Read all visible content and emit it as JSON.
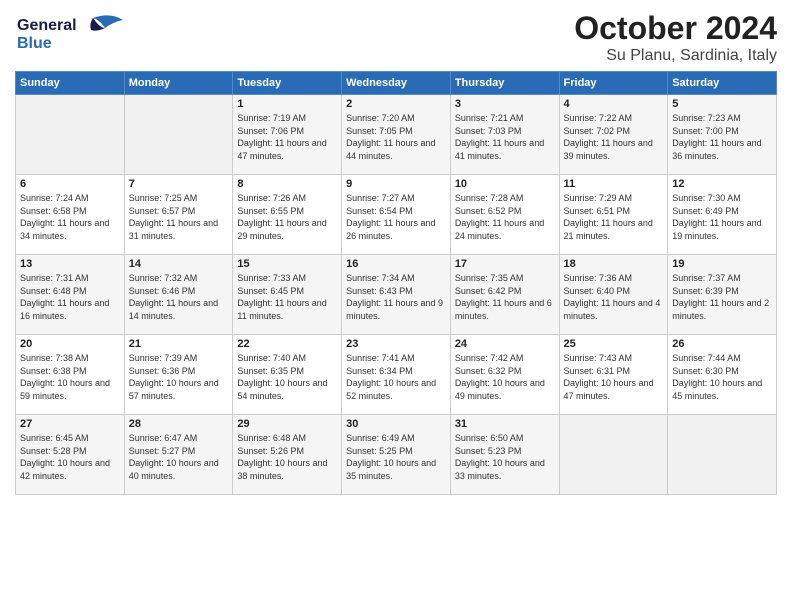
{
  "logo": {
    "line1": "General",
    "line2": "Blue"
  },
  "title": "October 2024",
  "subtitle": "Su Planu, Sardinia, Italy",
  "weekdays": [
    "Sunday",
    "Monday",
    "Tuesday",
    "Wednesday",
    "Thursday",
    "Friday",
    "Saturday"
  ],
  "weeks": [
    [
      {
        "day": "",
        "info": ""
      },
      {
        "day": "",
        "info": ""
      },
      {
        "day": "1",
        "info": "Sunrise: 7:19 AM\nSunset: 7:06 PM\nDaylight: 11 hours and 47 minutes."
      },
      {
        "day": "2",
        "info": "Sunrise: 7:20 AM\nSunset: 7:05 PM\nDaylight: 11 hours and 44 minutes."
      },
      {
        "day": "3",
        "info": "Sunrise: 7:21 AM\nSunset: 7:03 PM\nDaylight: 11 hours and 41 minutes."
      },
      {
        "day": "4",
        "info": "Sunrise: 7:22 AM\nSunset: 7:02 PM\nDaylight: 11 hours and 39 minutes."
      },
      {
        "day": "5",
        "info": "Sunrise: 7:23 AM\nSunset: 7:00 PM\nDaylight: 11 hours and 36 minutes."
      }
    ],
    [
      {
        "day": "6",
        "info": "Sunrise: 7:24 AM\nSunset: 6:58 PM\nDaylight: 11 hours and 34 minutes."
      },
      {
        "day": "7",
        "info": "Sunrise: 7:25 AM\nSunset: 6:57 PM\nDaylight: 11 hours and 31 minutes."
      },
      {
        "day": "8",
        "info": "Sunrise: 7:26 AM\nSunset: 6:55 PM\nDaylight: 11 hours and 29 minutes."
      },
      {
        "day": "9",
        "info": "Sunrise: 7:27 AM\nSunset: 6:54 PM\nDaylight: 11 hours and 26 minutes."
      },
      {
        "day": "10",
        "info": "Sunrise: 7:28 AM\nSunset: 6:52 PM\nDaylight: 11 hours and 24 minutes."
      },
      {
        "day": "11",
        "info": "Sunrise: 7:29 AM\nSunset: 6:51 PM\nDaylight: 11 hours and 21 minutes."
      },
      {
        "day": "12",
        "info": "Sunrise: 7:30 AM\nSunset: 6:49 PM\nDaylight: 11 hours and 19 minutes."
      }
    ],
    [
      {
        "day": "13",
        "info": "Sunrise: 7:31 AM\nSunset: 6:48 PM\nDaylight: 11 hours and 16 minutes."
      },
      {
        "day": "14",
        "info": "Sunrise: 7:32 AM\nSunset: 6:46 PM\nDaylight: 11 hours and 14 minutes."
      },
      {
        "day": "15",
        "info": "Sunrise: 7:33 AM\nSunset: 6:45 PM\nDaylight: 11 hours and 11 minutes."
      },
      {
        "day": "16",
        "info": "Sunrise: 7:34 AM\nSunset: 6:43 PM\nDaylight: 11 hours and 9 minutes."
      },
      {
        "day": "17",
        "info": "Sunrise: 7:35 AM\nSunset: 6:42 PM\nDaylight: 11 hours and 6 minutes."
      },
      {
        "day": "18",
        "info": "Sunrise: 7:36 AM\nSunset: 6:40 PM\nDaylight: 11 hours and 4 minutes."
      },
      {
        "day": "19",
        "info": "Sunrise: 7:37 AM\nSunset: 6:39 PM\nDaylight: 11 hours and 2 minutes."
      }
    ],
    [
      {
        "day": "20",
        "info": "Sunrise: 7:38 AM\nSunset: 6:38 PM\nDaylight: 10 hours and 59 minutes."
      },
      {
        "day": "21",
        "info": "Sunrise: 7:39 AM\nSunset: 6:36 PM\nDaylight: 10 hours and 57 minutes."
      },
      {
        "day": "22",
        "info": "Sunrise: 7:40 AM\nSunset: 6:35 PM\nDaylight: 10 hours and 54 minutes."
      },
      {
        "day": "23",
        "info": "Sunrise: 7:41 AM\nSunset: 6:34 PM\nDaylight: 10 hours and 52 minutes."
      },
      {
        "day": "24",
        "info": "Sunrise: 7:42 AM\nSunset: 6:32 PM\nDaylight: 10 hours and 49 minutes."
      },
      {
        "day": "25",
        "info": "Sunrise: 7:43 AM\nSunset: 6:31 PM\nDaylight: 10 hours and 47 minutes."
      },
      {
        "day": "26",
        "info": "Sunrise: 7:44 AM\nSunset: 6:30 PM\nDaylight: 10 hours and 45 minutes."
      }
    ],
    [
      {
        "day": "27",
        "info": "Sunrise: 6:45 AM\nSunset: 5:28 PM\nDaylight: 10 hours and 42 minutes."
      },
      {
        "day": "28",
        "info": "Sunrise: 6:47 AM\nSunset: 5:27 PM\nDaylight: 10 hours and 40 minutes."
      },
      {
        "day": "29",
        "info": "Sunrise: 6:48 AM\nSunset: 5:26 PM\nDaylight: 10 hours and 38 minutes."
      },
      {
        "day": "30",
        "info": "Sunrise: 6:49 AM\nSunset: 5:25 PM\nDaylight: 10 hours and 35 minutes."
      },
      {
        "day": "31",
        "info": "Sunrise: 6:50 AM\nSunset: 5:23 PM\nDaylight: 10 hours and 33 minutes."
      },
      {
        "day": "",
        "info": ""
      },
      {
        "day": "",
        "info": ""
      }
    ]
  ]
}
